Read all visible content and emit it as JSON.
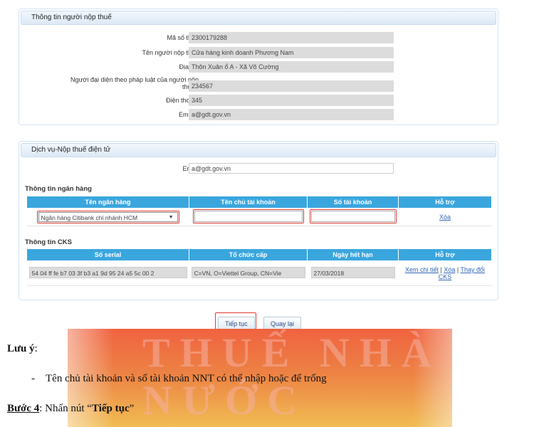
{
  "taxpayer_panel": {
    "title": "Thông tin người nộp thuế",
    "fields": [
      {
        "label": "Mã số thuế",
        "value": "2300179288",
        "required": false
      },
      {
        "label": "Tên người nộp thuế",
        "value": "Cửa hàng kinh doanh Phương Nam",
        "required": false
      },
      {
        "label": "Địa chỉ",
        "value": "Thôn Xuân ổ A - Xã Võ Cường",
        "required": false
      },
      {
        "label": "Người đại diện theo pháp luật của người nộp thuế",
        "label_line1": "Người đại diện theo pháp luật của người nộp",
        "label_line2": "thuế",
        "value": "234567",
        "required": true
      },
      {
        "label": "Điện thoại",
        "value": "345",
        "required": true
      },
      {
        "label": "Email",
        "value": "a@gdt.gov.vn",
        "required": true
      }
    ]
  },
  "service_panel": {
    "title": "Dịch vụ-Nộp thuế điện tử",
    "email_label": "Email",
    "email_value": "a@gdt.gov.vn",
    "bank_section": "Thông tin ngân hàng",
    "bank_headers": [
      "Tên ngân hàng",
      "Tên chủ tài khoản",
      "Số tài khoản",
      "Hỗ trợ"
    ],
    "bank_row": {
      "bank": "Ngân hàng Citibank chi nhánh HCM",
      "holder": "",
      "account": "",
      "action": "Xóa"
    },
    "cks_section": "Thông tin CKS",
    "cks_headers": [
      "Số serial",
      "Tổ chức cấp",
      "Ngày hết hạn",
      "Hỗ trợ"
    ],
    "cks_row": {
      "serial": "54 04 ff fe b7 03 3f b3 a1 9d 95 24 a5 5c 00 2",
      "issuer": "C=VN, O=Viettel Group, CN=Vie",
      "expiry": "27/03/2018",
      "actions": [
        "Xem chi tiết",
        "Xóa",
        "Thay đổi CKS"
      ]
    }
  },
  "buttons": {
    "continue": "Tiếp tục",
    "back": "Quay lại"
  },
  "document": {
    "watermark": "THUẾ NHÀ NƯỚC",
    "note_title": "Lưu ý",
    "note_item": "Tên chủ tài khoản và số tài khoản NNT có thể nhập hoặc để trống",
    "step_label": "Bước 4",
    "step_text_before": ": Nhấn nút “",
    "step_bold": "Tiếp tục",
    "step_text_after": "”"
  },
  "colors": {
    "table_header": "#3aa6de",
    "highlight": "#e03a30",
    "banner": "#ef5a36"
  }
}
